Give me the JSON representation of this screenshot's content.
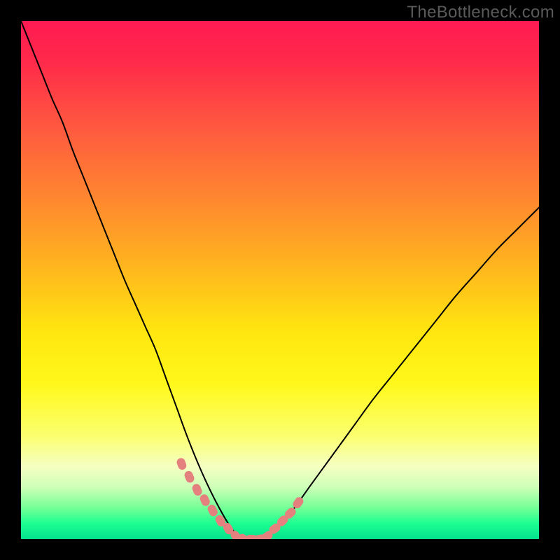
{
  "watermark": {
    "text": "TheBottleneck.com"
  },
  "colors": {
    "frame": "#000000",
    "curve": "#000000",
    "marker": "#e4817e",
    "gradient_top": "#ff1a52",
    "gradient_bottom": "#04e28d"
  },
  "chart_data": {
    "type": "line",
    "title": "",
    "xlabel": "",
    "ylabel": "",
    "xlim": [
      0,
      100
    ],
    "ylim": [
      0,
      100
    ],
    "grid": false,
    "legend": false,
    "series": [
      {
        "name": "bottleneck-curve",
        "x": [
          0,
          2,
          4,
          6,
          8,
          10,
          12,
          14,
          16,
          18,
          20,
          22,
          24,
          26,
          28,
          30,
          32,
          34,
          36,
          38,
          40,
          41.5,
          43,
          45,
          47,
          49,
          52,
          56,
          60,
          64,
          68,
          72,
          76,
          80,
          84,
          88,
          92,
          96,
          100
        ],
        "y": [
          100,
          95,
          90,
          85,
          80.5,
          75,
          70,
          65,
          60,
          55,
          50,
          45.5,
          41,
          36.5,
          31,
          25.5,
          20,
          15,
          10.5,
          6.5,
          3,
          1,
          0,
          0,
          0.5,
          2,
          5,
          10.5,
          16,
          21.5,
          27,
          32,
          37,
          42,
          47,
          51.5,
          56,
          60,
          64
        ]
      }
    ],
    "markers": [
      {
        "segment": "left",
        "x": [
          31,
          32.5,
          34,
          35.5,
          37,
          38.5,
          40
        ],
        "y": [
          14.5,
          12,
          9.5,
          7.5,
          5.5,
          3.5,
          2
        ]
      },
      {
        "segment": "floor",
        "x": [
          41.5,
          43,
          44.5,
          46,
          47.5
        ],
        "y": [
          0.5,
          0,
          0,
          0,
          0.5
        ]
      },
      {
        "segment": "right",
        "x": [
          49,
          50.5,
          52,
          53.5
        ],
        "y": [
          2,
          3.5,
          5,
          7
        ]
      }
    ],
    "notes": "Axes are unlabeled in the source image; x/y expressed as 0–100 percent of the visible plotting area. y = 0 is the bottom (green). Values are estimated from pixel positions."
  }
}
